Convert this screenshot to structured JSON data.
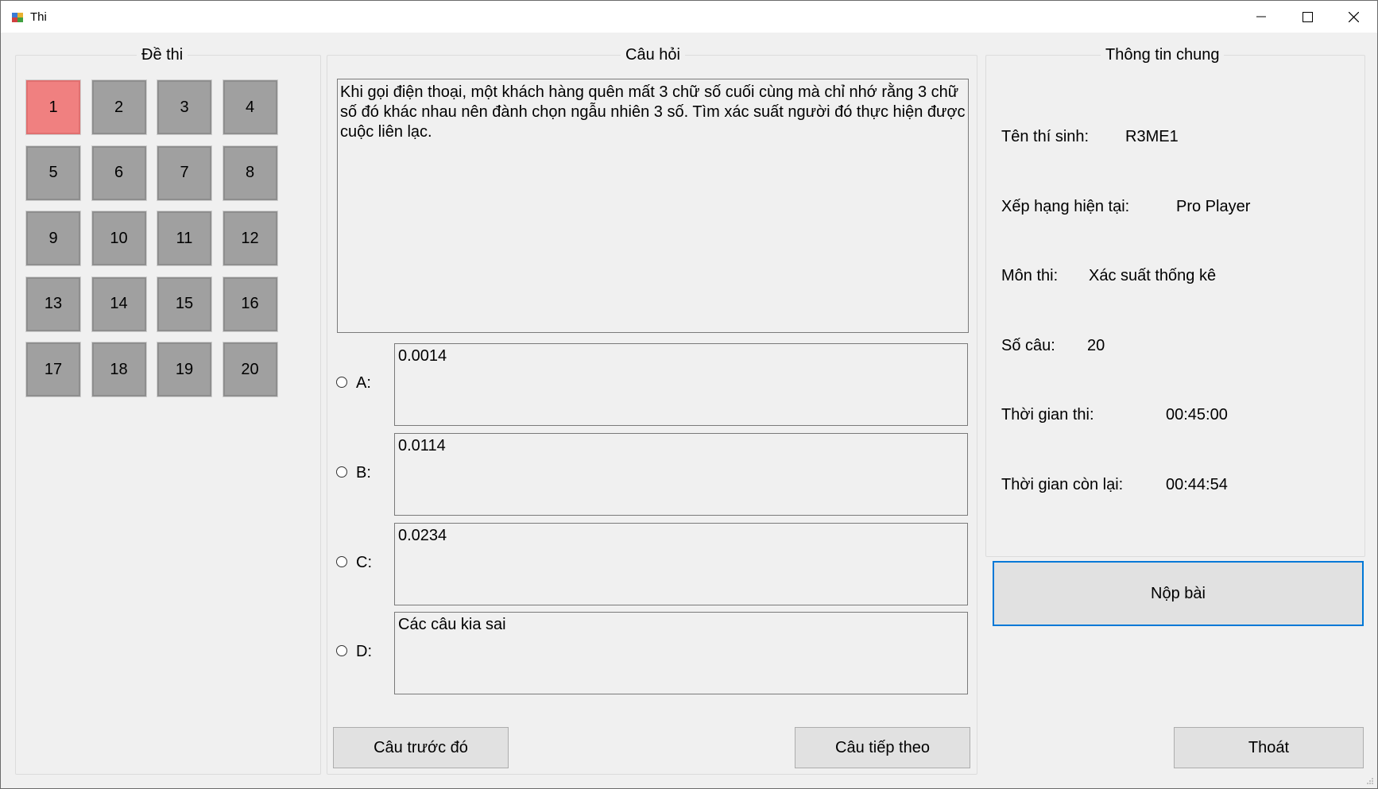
{
  "window": {
    "title": "Thi",
    "minimize_glyph": "─",
    "maximize_glyph": "☐",
    "close_glyph": "✕"
  },
  "exam_panel": {
    "title": "Đề thi",
    "questions": [
      "1",
      "2",
      "3",
      "4",
      "5",
      "6",
      "7",
      "8",
      "9",
      "10",
      "11",
      "12",
      "13",
      "14",
      "15",
      "16",
      "17",
      "18",
      "19",
      "20"
    ],
    "current": "1",
    "current_color": "#f08080",
    "default_color": "#a0a0a0"
  },
  "question_panel": {
    "title": "Câu hỏi",
    "question_text": "Khi gọi điện thoại, một khách hàng quên mất 3 chữ số cuối cùng mà chỉ nhớ rằng 3 chữ số đó khác nhau nên đành chọn ngẫu nhiên 3 số. Tìm xác suất người đó thực hiện được cuộc liên lạc.",
    "options": [
      {
        "label": "A:",
        "text": "0.0014"
      },
      {
        "label": "B:",
        "text": "0.0114"
      },
      {
        "label": "C:",
        "text": "0.0234"
      },
      {
        "label": "D:",
        "text": "Các câu kia sai"
      }
    ],
    "prev_button": "Câu trước đó",
    "next_button": "Câu tiếp theo"
  },
  "info_panel": {
    "title": "Thông tin chung",
    "candidate_label": "Tên thí sinh:",
    "candidate_value": "R3ME1",
    "rank_label": "Xếp hạng hiện tại:",
    "rank_value": "Pro Player",
    "subject_label": "Môn thi:",
    "subject_value": "Xác suất thống kê",
    "count_label": "Số câu:",
    "count_value": "20",
    "duration_label": "Thời gian thi:",
    "duration_value": "00:45:00",
    "remaining_label": "Thời gian còn lại:",
    "remaining_value": "00:44:54",
    "submit_button": "Nộp bài",
    "exit_button": "Thoát"
  },
  "colors": {
    "accent_border": "#0078d7",
    "window_bg": "#f0f0f0"
  }
}
